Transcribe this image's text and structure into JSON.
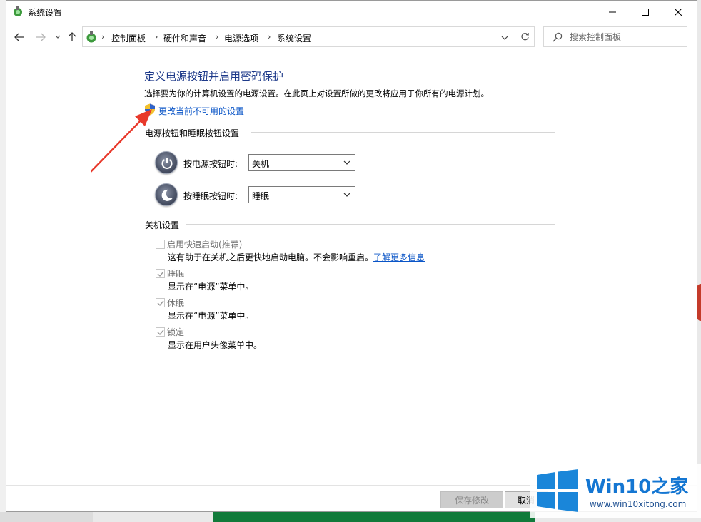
{
  "window": {
    "title": "系统设置",
    "icons": {
      "app": "control-panel-icon",
      "minimize": "minimize-icon",
      "maximize": "maximize-icon",
      "close": "close-icon"
    }
  },
  "nav": {
    "icons": [
      "back-arrow-icon",
      "forward-arrow-icon",
      "recent-dropdown-icon",
      "up-arrow-icon"
    ],
    "breadcrumb": [
      "控制面板",
      "硬件和声音",
      "电源选项",
      "系统设置"
    ],
    "search_placeholder": "搜索控制面板"
  },
  "page": {
    "heading": "定义电源按钮并启用密码保护",
    "description": "选择要为你的计算机设置的电源设置。在此页上对设置所做的更改将应用于你所有的电源计划。",
    "change_link": "更改当前不可用的设置"
  },
  "power_buttons": {
    "section_title": "电源按钮和睡眠按钮设置",
    "power": {
      "label": "按电源按钮时:",
      "value": "关机"
    },
    "sleep": {
      "label": "按睡眠按钮时:",
      "value": "睡眠"
    }
  },
  "shutdown": {
    "section_title": "关机设置",
    "items": [
      {
        "label": "启用快速启动(推荐)",
        "checked": false,
        "desc": "这有助于在关机之后更快地启动电脑。不会影响重启。",
        "link": "了解更多信息"
      },
      {
        "label": "睡眠",
        "checked": true,
        "desc": "显示在“电源”菜单中。"
      },
      {
        "label": "休眠",
        "checked": true,
        "desc": "显示在“电源”菜单中。"
      },
      {
        "label": "锁定",
        "checked": true,
        "desc": "显示在用户头像菜单中。"
      }
    ]
  },
  "footer": {
    "save_label": "保存修改",
    "cancel_label": "取消"
  },
  "watermark": {
    "title": "Win10",
    "title_cn": "之家",
    "url": "www.win10xitong.com"
  },
  "colors": {
    "heading": "#1e3a8a",
    "link": "#0a55c7",
    "annotation_arrow": "#e8392b",
    "watermark_blue": "#1476d2"
  }
}
